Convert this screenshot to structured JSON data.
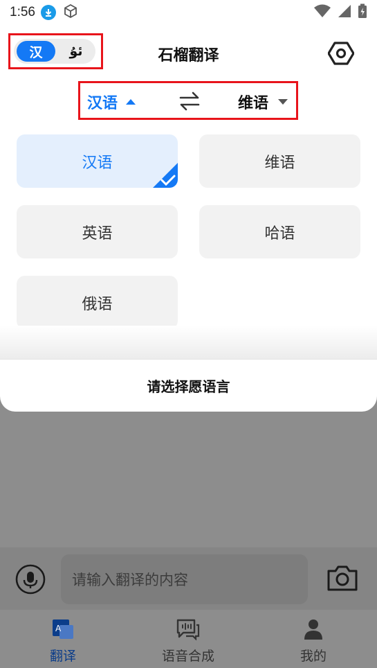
{
  "status_bar": {
    "time": "1:56"
  },
  "header": {
    "lang_toggle": {
      "active": "汉",
      "inactive": "ئۇ"
    },
    "title": "石榴翻译"
  },
  "lang_bar": {
    "source": "汉语",
    "target": "维语"
  },
  "languages": [
    {
      "label": "汉语",
      "selected": true
    },
    {
      "label": "维语",
      "selected": false
    },
    {
      "label": "英语",
      "selected": false
    },
    {
      "label": "哈语",
      "selected": false
    },
    {
      "label": "俄语",
      "selected": false
    }
  ],
  "sheet": {
    "prompt": "请选择愿语言"
  },
  "input": {
    "placeholder": "请输入翻译的内容"
  },
  "tabs": [
    {
      "label": "翻译",
      "active": true
    },
    {
      "label": "语音合成",
      "active": false
    },
    {
      "label": "我的",
      "active": false
    }
  ],
  "colors": {
    "accent": "#1479f5",
    "highlight_box": "#e8141b",
    "selected_bg": "#e4effd",
    "card_bg": "#f2f2f2",
    "overlay": "#8d8d8d"
  }
}
